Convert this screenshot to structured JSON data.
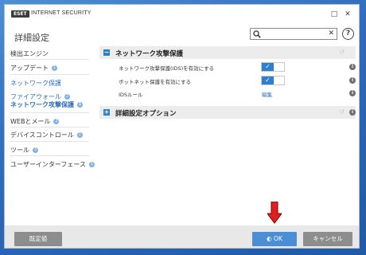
{
  "titlebar": {
    "logo": "ESET",
    "app_name": "INTERNET SECURITY",
    "minimize_glyph": "□",
    "close_glyph": "✕"
  },
  "page": {
    "title": "詳細設定"
  },
  "search": {
    "value": "",
    "clear_glyph": "✕"
  },
  "help": {
    "label": "?"
  },
  "sidebar": {
    "items": [
      {
        "label": "検出エンジン",
        "badge": ""
      },
      {
        "label": "アップデート",
        "badge": "1"
      },
      {
        "label": "ネットワーク保護",
        "badge": ""
      },
      {
        "label": "ファイアウォール",
        "badge": "2"
      },
      {
        "label": "ネットワーク攻撃保護",
        "badge": "1"
      },
      {
        "label": "WEBとメール",
        "badge": "2"
      },
      {
        "label": "デバイスコントロール",
        "badge": "1"
      },
      {
        "label": "ツール",
        "badge": "3"
      },
      {
        "label": "ユーザーインターフェース",
        "badge": "1"
      }
    ]
  },
  "main": {
    "section1": {
      "toggle_glyph": "−",
      "title": "ネットワーク攻撃保護",
      "rows": [
        {
          "label": "ネットワーク攻撃保護(IDS)を有効にする",
          "toggle": "✓"
        },
        {
          "label": "ボットネット保護を有効にする",
          "toggle": "✓"
        },
        {
          "label": "IDSルール",
          "link": "編集"
        }
      ]
    },
    "section2": {
      "toggle_glyph": "+",
      "title": "詳細設定オプション"
    }
  },
  "footer": {
    "default_label": "既定値",
    "ok_label": "OK",
    "cancel_label": "キャンセル"
  },
  "colors": {
    "accent": "#2f7fcf",
    "ok_button": "#4a8fd6",
    "arrow": "#e02020"
  }
}
